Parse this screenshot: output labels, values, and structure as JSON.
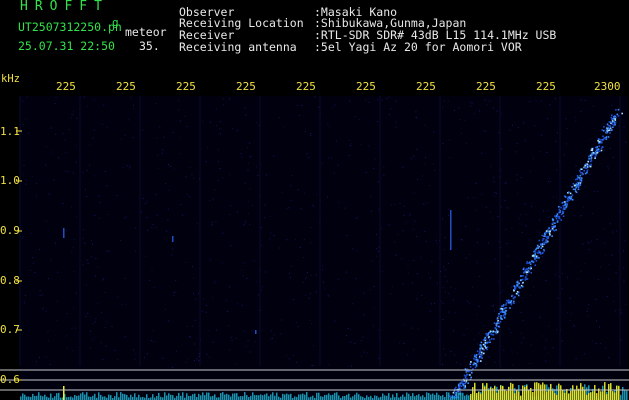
{
  "header": {
    "title": "HROFFT",
    "filename": "UT2507312250.pn",
    "filename_ext": "g",
    "datetime": "25.07.31 22:50",
    "meteor_label": "meteor",
    "number": "35.",
    "fields": [
      {
        "label": "Observer",
        "value": ":Masaki Kano"
      },
      {
        "label": "Receiving Location",
        "value": ":Shibukawa,Gunma,Japan"
      },
      {
        "label": "Receiver",
        "value": ":RTL-SDR SDR# 43dB L15 114.1MHz USB"
      },
      {
        "label": "Receiving antenna",
        "value": ":5el Yagi Az 20 for Aomori VOR"
      }
    ]
  },
  "spectrogram": {
    "y_unit": "kHz",
    "y_ticks": [
      "1.1",
      "1.0",
      "0.9",
      "0.8",
      "0.7",
      "0.6"
    ],
    "x_ticks": [
      "225",
      "225",
      "225",
      "225",
      "225",
      "225",
      "225",
      "225",
      "225",
      "2300"
    ],
    "colors": {
      "label": "#f0e040",
      "title": "#33e24a",
      "text": "#e8e8e8",
      "signal": "#3a8cff",
      "bg": "#000011"
    }
  }
}
